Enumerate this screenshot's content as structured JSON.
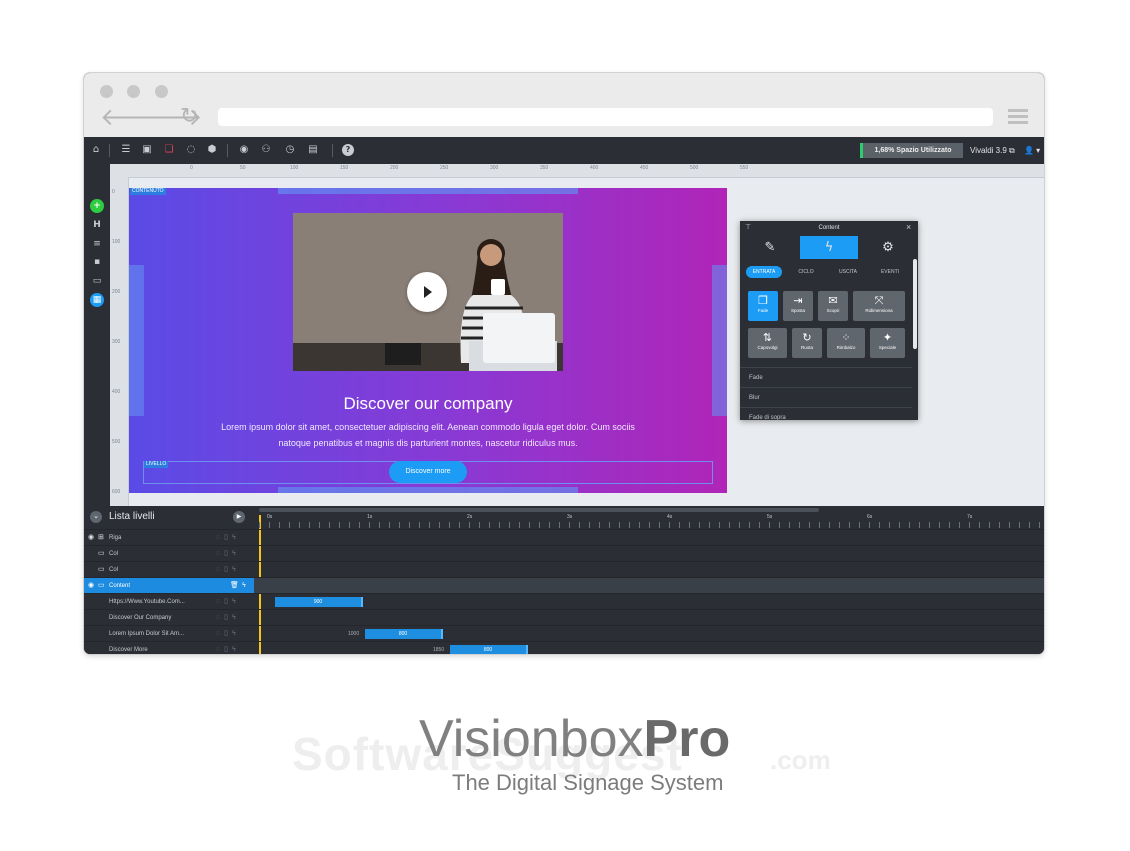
{
  "toolbar": {
    "icons": [
      "home-icon",
      "list-icon",
      "image-icon",
      "layers-icon",
      "palette-icon",
      "box-icon",
      "eye-icon",
      "user-group-icon",
      "clock-icon",
      "template-icon",
      "help-icon"
    ],
    "storage_label": "1,68% Spazio Utilizzato",
    "version_label": "Vivaldi 3.9 ⧉",
    "user_label": "👤 ▾"
  },
  "ruler": {
    "h_labels": [
      "0",
      "50",
      "100",
      "150",
      "200",
      "250",
      "300",
      "350",
      "400",
      "450",
      "500",
      "550",
      "600",
      "650",
      "700"
    ],
    "v_labels": [
      "0",
      "100",
      "200",
      "300",
      "400",
      "500",
      "600"
    ]
  },
  "slide": {
    "tag_content": "CONTENUTO",
    "tag_layer": "LIVELLO",
    "title": "Discover our company",
    "body_line1": "Lorem ipsum dolor sit amet, consectetuer adipiscing elit. Aenean commodo ligula eget dolor. Cum sociis",
    "body_line2": "natoque penatibus et magnis dis parturient montes, nascetur ridiculus mus.",
    "cta_label": "Discover more"
  },
  "panel": {
    "title": "Content",
    "subtabs": [
      "ENTRATA",
      "CICLO",
      "USCITA",
      "EVENTI"
    ],
    "effects": [
      {
        "label": "Fade",
        "glyph": "❐",
        "active": true
      },
      {
        "label": "Sposta",
        "glyph": "⇥"
      },
      {
        "label": "Scopri",
        "glyph": "✉"
      },
      {
        "label": "Ridimensiona",
        "glyph": "⤧"
      },
      {
        "label": "Capovolgi",
        "glyph": "⇅"
      },
      {
        "label": "Ruota",
        "glyph": "↻"
      },
      {
        "label": "Rimbalzo",
        "glyph": "⁘"
      },
      {
        "label": "Speciale",
        "glyph": "✦"
      }
    ],
    "list": [
      "Fade",
      "Blur",
      "Fade di sopra"
    ]
  },
  "timeline": {
    "title": "Lista livelli",
    "ticks": [
      "0s",
      "1s",
      "2s",
      "3s",
      "4s",
      "5s",
      "6s",
      "7s"
    ],
    "rows": [
      {
        "label": "Riga",
        "active": false
      },
      {
        "label": "Col",
        "active": false
      },
      {
        "label": "Col",
        "active": false
      },
      {
        "label": "Content",
        "active": true
      },
      {
        "label": "Https://Www.Youtube.Com...",
        "start": "",
        "bar": "900"
      },
      {
        "label": "Discover Our Company",
        "start": "",
        "bar": ""
      },
      {
        "label": "Lorem Ipsum Dolor Sit Am...",
        "start": "1000",
        "bar": "800"
      },
      {
        "label": "Discover More",
        "start": "1850",
        "bar": "800"
      }
    ]
  },
  "branding": {
    "name_light": "Visionbox",
    "name_bold": "Pro",
    "tagline": "The Digital Signage System",
    "watermark": "SoftwareSuggest",
    "watermark_com": ".com"
  },
  "colors": {
    "accent": "#1c9cf4",
    "gradient_start": "#5a4be6",
    "gradient_end": "#b025b7",
    "toolbar_bg": "#2b2f35"
  }
}
